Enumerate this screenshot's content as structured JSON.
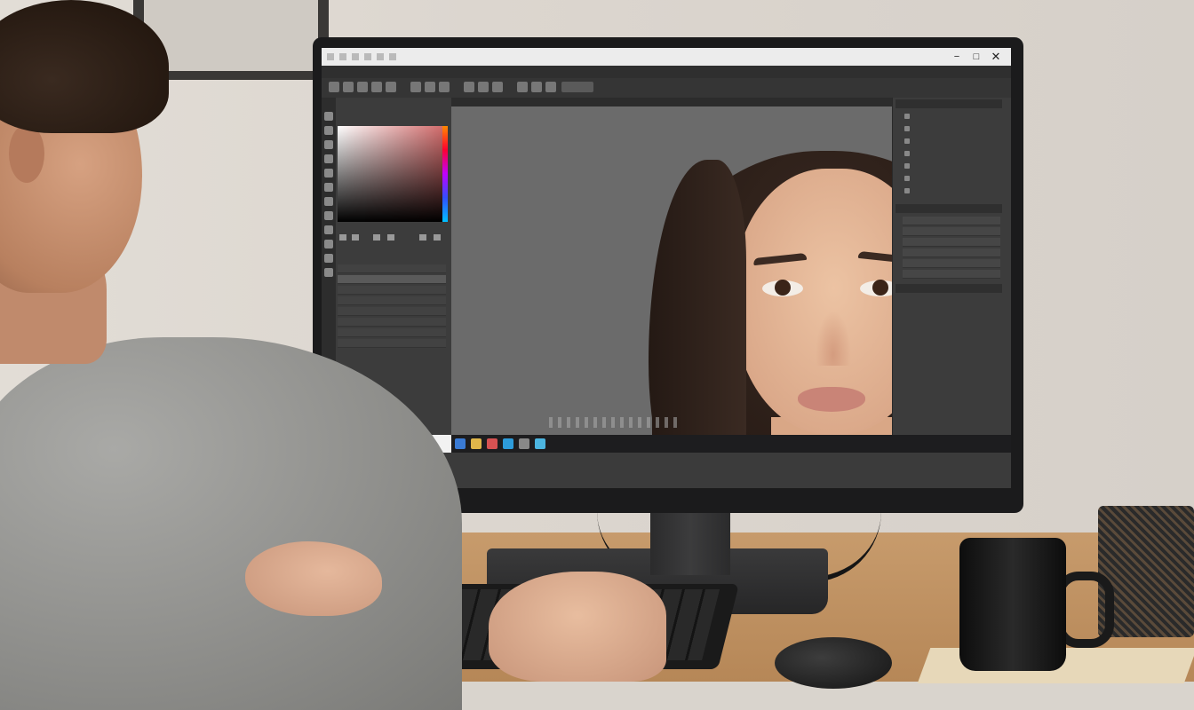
{
  "scene": {
    "description_tag": "photo-editor-on-monitor",
    "colors": {
      "wall": "#dcd6cf",
      "desk": "#c79b6c",
      "monitor": "#1b1b1c",
      "editor_panel": "#3c3c3c",
      "editor_canvas_bg": "#6b6b6b"
    }
  },
  "editor": {
    "titlebar_icons": {
      "minimize": "−",
      "maximize": "□",
      "close": "✕"
    },
    "left_panel": {
      "icons": [
        "color-picker-icon",
        "swatch-icon",
        "layer-icon",
        "eye-icon",
        "lock-icon"
      ]
    },
    "right_panel": {
      "icons": [
        "adjustment-icon",
        "properties-icon",
        "history-icon",
        "settings-icon"
      ]
    },
    "taskbar_icons": [
      "start-icon",
      "folder-icon",
      "browser-icon",
      "editor-app-icon",
      "mail-icon",
      "store-icon",
      "chat-icon"
    ]
  }
}
